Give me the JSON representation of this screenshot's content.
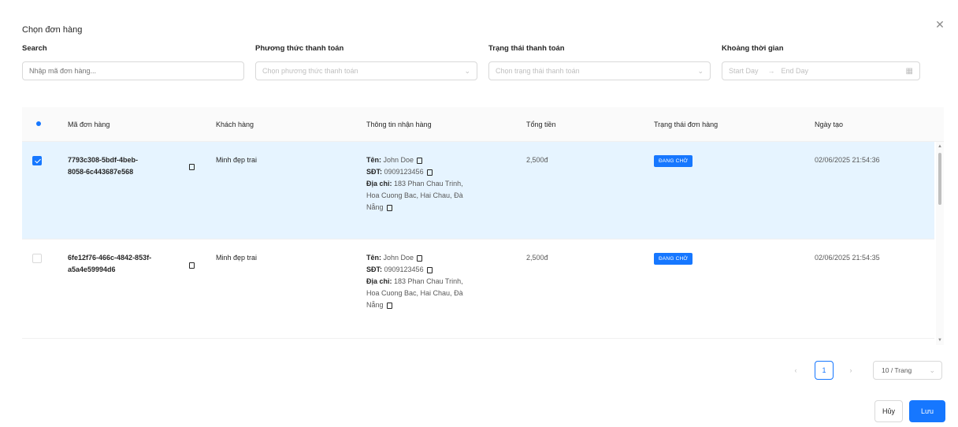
{
  "modal": {
    "title": "Chọn đơn hàng",
    "close_icon": "close-icon"
  },
  "filters": {
    "search": {
      "label": "Search",
      "placeholder": "Nhập mã đơn hàng..."
    },
    "payment_method": {
      "label": "Phương thức thanh toán",
      "placeholder": "Chọn phương thức thanh toán"
    },
    "payment_status": {
      "label": "Trạng thái thanh toán",
      "placeholder": "Chọn trạng thái thanh toán"
    },
    "time_range": {
      "label": "Khoảng thời gian",
      "start_placeholder": "Start Day",
      "end_placeholder": "End Day"
    }
  },
  "table": {
    "columns": [
      "Mã đơn hàng",
      "Khách hàng",
      "Thông tin nhận hàng",
      "Tổng tiền",
      "Trạng thái đơn hàng",
      "Ngày tạo"
    ],
    "rows": [
      {
        "selected": true,
        "order_id_line1": "7793c308-5bdf-4beb-",
        "order_id_line2": "8058-6c443687e568",
        "customer": "Minh đẹp trai",
        "name_label": "Tên:",
        "name_value": "John Doe",
        "phone_label": "SĐT:",
        "phone_value": "0909123456",
        "address_label": "Địa chỉ:",
        "address_line1": "183 Phan Chau Trinh,",
        "address_line2": "Hoa Cuong Bac, Hai Chau, Đà",
        "address_line3": "Nẵng",
        "total": "2,500đ",
        "status": "ĐANG CHỜ",
        "created": "02/06/2025 21:54:36"
      },
      {
        "selected": false,
        "order_id_line1": "6fe12f76-466c-4842-853f-",
        "order_id_line2": "a5a4e59994d6",
        "customer": "Minh đẹp trai",
        "name_label": "Tên:",
        "name_value": "John Doe",
        "phone_label": "SĐT:",
        "phone_value": "0909123456",
        "address_label": "Địa chỉ:",
        "address_line1": "183 Phan Chau Trinh,",
        "address_line2": "Hoa Cuong Bac, Hai Chau, Đà",
        "address_line3": "Nẵng",
        "total": "2,500đ",
        "status": "ĐANG CHỜ",
        "created": "02/06/2025 21:54:35"
      }
    ]
  },
  "pagination": {
    "current_page": "1",
    "page_size": "10 / Trang"
  },
  "footer": {
    "cancel_label": "Hủy",
    "ok_label": "Lưu"
  },
  "colors": {
    "primary": "#1677ff",
    "selected_row": "#e6f4ff"
  }
}
